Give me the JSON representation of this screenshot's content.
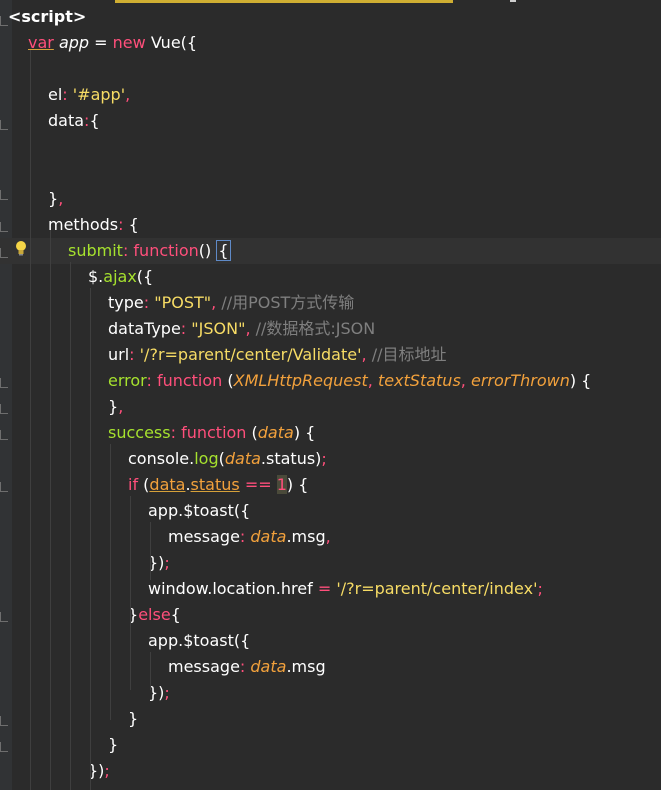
{
  "editor": {
    "lines": [
      {
        "id": "l1",
        "tokens": [
          {
            "c": "tag",
            "t": "<script>"
          }
        ]
      },
      {
        "id": "l2",
        "tokens": [
          {
            "c": "kw-var",
            "t": "var"
          },
          {
            "c": "plain",
            "t": " "
          },
          {
            "c": "ident",
            "t": "app"
          },
          {
            "c": "plain",
            "t": " = "
          },
          {
            "c": "kw",
            "t": "new"
          },
          {
            "c": "plain",
            "t": " Vue({"
          }
        ]
      },
      {
        "id": "l3",
        "tokens": []
      },
      {
        "id": "l4",
        "tokens": [
          {
            "c": "prop",
            "t": "el"
          },
          {
            "c": "punc",
            "t": ":"
          },
          {
            "c": "plain",
            "t": " "
          },
          {
            "c": "str",
            "t": "'#app'"
          },
          {
            "c": "punc",
            "t": ","
          }
        ]
      },
      {
        "id": "l5",
        "tokens": [
          {
            "c": "prop",
            "t": "data"
          },
          {
            "c": "punc",
            "t": ":"
          },
          {
            "c": "plain",
            "t": "{"
          }
        ]
      },
      {
        "id": "l6",
        "tokens": []
      },
      {
        "id": "l7",
        "tokens": []
      },
      {
        "id": "l8",
        "tokens": [
          {
            "c": "plain",
            "t": "}"
          },
          {
            "c": "punc",
            "t": ","
          }
        ]
      },
      {
        "id": "l9",
        "tokens": [
          {
            "c": "prop",
            "t": "methods"
          },
          {
            "c": "punc",
            "t": ":"
          },
          {
            "c": "plain",
            "t": " {"
          }
        ]
      },
      {
        "id": "l10",
        "tokens": [
          {
            "c": "fn-key",
            "t": "submit"
          },
          {
            "c": "punc",
            "t": ":"
          },
          {
            "c": "plain",
            "t": " "
          },
          {
            "c": "kw",
            "t": "function"
          },
          {
            "c": "plain",
            "t": "() "
          },
          {
            "c": "bracket",
            "t": "{"
          }
        ]
      },
      {
        "id": "l11",
        "tokens": [
          {
            "c": "plain",
            "t": "$."
          },
          {
            "c": "fn-key",
            "t": "ajax"
          },
          {
            "c": "plain",
            "t": "({"
          }
        ]
      },
      {
        "id": "l12",
        "tokens": [
          {
            "c": "prop",
            "t": "type"
          },
          {
            "c": "punc",
            "t": ":"
          },
          {
            "c": "plain",
            "t": " "
          },
          {
            "c": "str",
            "t": "\"POST\""
          },
          {
            "c": "punc",
            "t": ","
          },
          {
            "c": "plain",
            "t": " "
          },
          {
            "c": "cmt",
            "t": "//用POST方式传输"
          }
        ]
      },
      {
        "id": "l13",
        "tokens": [
          {
            "c": "prop",
            "t": "dataType"
          },
          {
            "c": "punc",
            "t": ":"
          },
          {
            "c": "plain",
            "t": " "
          },
          {
            "c": "str",
            "t": "\"JSON\""
          },
          {
            "c": "punc",
            "t": ","
          },
          {
            "c": "plain",
            "t": " "
          },
          {
            "c": "cmt",
            "t": "//数据格式:JSON"
          }
        ]
      },
      {
        "id": "l14",
        "tokens": [
          {
            "c": "prop",
            "t": "url"
          },
          {
            "c": "punc",
            "t": ":"
          },
          {
            "c": "plain",
            "t": " "
          },
          {
            "c": "str",
            "t": "'/?r=parent/center/Validate'"
          },
          {
            "c": "punc",
            "t": ","
          },
          {
            "c": "plain",
            "t": " "
          },
          {
            "c": "cmt",
            "t": "//目标地址"
          }
        ]
      },
      {
        "id": "l15",
        "tokens": [
          {
            "c": "fn-key",
            "t": "error"
          },
          {
            "c": "punc",
            "t": ":"
          },
          {
            "c": "plain",
            "t": " "
          },
          {
            "c": "kw",
            "t": "function"
          },
          {
            "c": "plain",
            "t": " ("
          },
          {
            "c": "param",
            "t": "XMLHttpRequest"
          },
          {
            "c": "punc",
            "t": ","
          },
          {
            "c": "plain",
            "t": " "
          },
          {
            "c": "param",
            "t": "textStatus"
          },
          {
            "c": "punc",
            "t": ","
          },
          {
            "c": "plain",
            "t": " "
          },
          {
            "c": "param",
            "t": "errorThrown"
          },
          {
            "c": "plain",
            "t": ") {"
          }
        ]
      },
      {
        "id": "l16",
        "tokens": [
          {
            "c": "plain",
            "t": "}"
          },
          {
            "c": "punc",
            "t": ","
          }
        ]
      },
      {
        "id": "l17",
        "tokens": [
          {
            "c": "fn-key",
            "t": "success"
          },
          {
            "c": "punc",
            "t": ":"
          },
          {
            "c": "plain",
            "t": " "
          },
          {
            "c": "kw",
            "t": "function"
          },
          {
            "c": "plain",
            "t": " ("
          },
          {
            "c": "param",
            "t": "data"
          },
          {
            "c": "plain",
            "t": ") {"
          }
        ]
      },
      {
        "id": "l18",
        "tokens": [
          {
            "c": "plain",
            "t": "console."
          },
          {
            "c": "fn-key",
            "t": "log"
          },
          {
            "c": "plain",
            "t": "("
          },
          {
            "c": "param",
            "t": "data"
          },
          {
            "c": "plain",
            "t": ".status)"
          },
          {
            "c": "punc",
            "t": ";"
          }
        ]
      },
      {
        "id": "l19",
        "tokens": [
          {
            "c": "kw",
            "t": "if"
          },
          {
            "c": "plain",
            "t": " ("
          },
          {
            "c": "hl-match",
            "t": "data"
          },
          {
            "c": "plain",
            "t": "."
          },
          {
            "c": "hl-status",
            "t": "status"
          },
          {
            "c": "plain",
            "t": " "
          },
          {
            "c": "hl-op",
            "t": "=="
          },
          {
            "c": "plain",
            "t": " "
          },
          {
            "c": "hl-num",
            "t": "1"
          },
          {
            "c": "plain",
            "t": ") {"
          }
        ]
      },
      {
        "id": "l20",
        "tokens": [
          {
            "c": "plain",
            "t": "app.$toast({"
          }
        ]
      },
      {
        "id": "l21",
        "tokens": [
          {
            "c": "prop",
            "t": "message"
          },
          {
            "c": "punc",
            "t": ":"
          },
          {
            "c": "plain",
            "t": " "
          },
          {
            "c": "param2",
            "t": "data"
          },
          {
            "c": "plain",
            "t": ".msg"
          },
          {
            "c": "punc",
            "t": ","
          }
        ]
      },
      {
        "id": "l22",
        "tokens": [
          {
            "c": "plain",
            "t": "})"
          },
          {
            "c": "punc",
            "t": ";"
          }
        ]
      },
      {
        "id": "l23",
        "tokens": [
          {
            "c": "plain",
            "t": "window.location.href "
          },
          {
            "c": "punc",
            "t": "="
          },
          {
            "c": "plain",
            "t": " "
          },
          {
            "c": "str",
            "t": "'/?r=parent/center/index'"
          },
          {
            "c": "punc",
            "t": ";"
          }
        ]
      },
      {
        "id": "l24",
        "tokens": [
          {
            "c": "plain",
            "t": "}"
          },
          {
            "c": "kw",
            "t": "else"
          },
          {
            "c": "plain",
            "t": "{"
          }
        ]
      },
      {
        "id": "l25",
        "tokens": [
          {
            "c": "plain",
            "t": "app.$toast({"
          }
        ]
      },
      {
        "id": "l26",
        "tokens": [
          {
            "c": "prop",
            "t": "message"
          },
          {
            "c": "punc",
            "t": ":"
          },
          {
            "c": "plain",
            "t": " "
          },
          {
            "c": "param2",
            "t": "data"
          },
          {
            "c": "plain",
            "t": ".msg"
          }
        ]
      },
      {
        "id": "l27",
        "tokens": [
          {
            "c": "plain",
            "t": "})"
          },
          {
            "c": "punc",
            "t": ";"
          }
        ]
      },
      {
        "id": "l28",
        "tokens": [
          {
            "c": "plain",
            "t": "}"
          }
        ]
      },
      {
        "id": "l29",
        "tokens": [
          {
            "c": "plain",
            "t": "}"
          }
        ]
      },
      {
        "id": "l30",
        "tokens": [
          {
            "c": "plain",
            "t": "})"
          },
          {
            "c": "punc",
            "t": ";"
          }
        ]
      }
    ],
    "colors": {
      "background": "#2b2b2b",
      "keyword": "#ff4f7b",
      "string": "#f7dc65",
      "comment": "#7f7f7f",
      "function_key": "#a6e22e",
      "parameter": "#f2a13c"
    },
    "icons": {
      "bulb": "lightbulb-icon"
    }
  }
}
